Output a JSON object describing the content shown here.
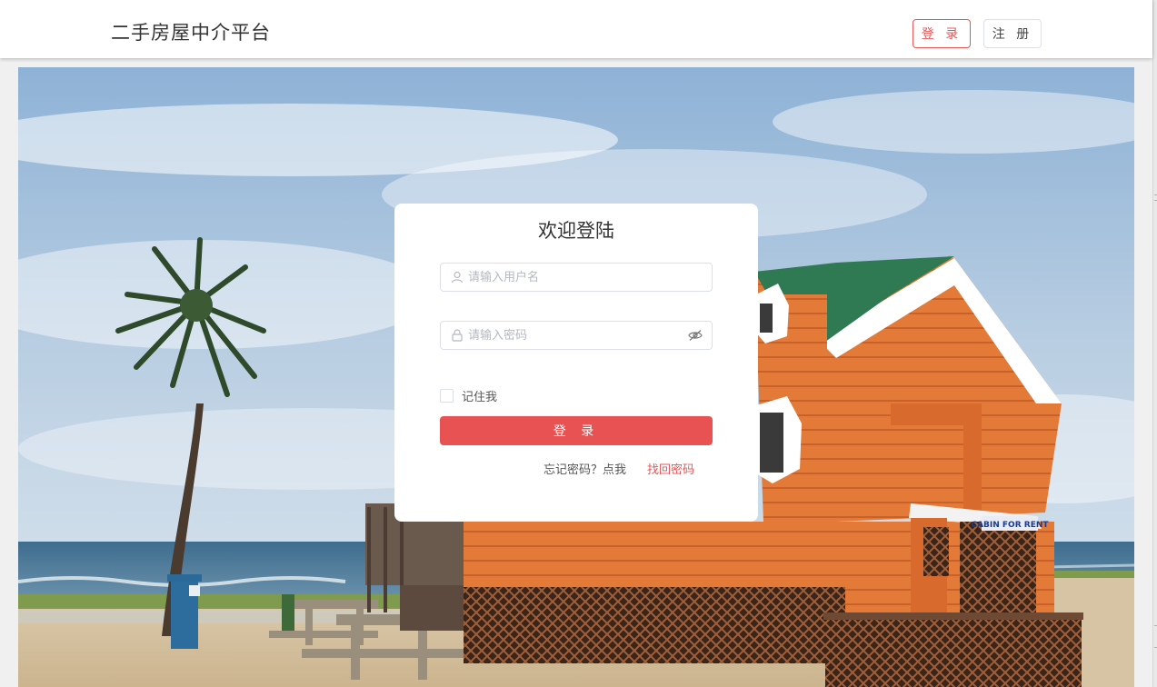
{
  "header": {
    "brand": "二手房屋中介平台",
    "login_label": "登 录",
    "register_label": "注 册"
  },
  "login_card": {
    "title": "欢迎登陆",
    "username_placeholder": "请输入用户名",
    "password_placeholder": "请输入密码",
    "remember_label": "记住我",
    "submit_label": "登 录",
    "forgot_text": "忘记密码？点我",
    "recover_link": "找回密码"
  },
  "background_sign": "CABIN FOR RENT",
  "colors": {
    "accent": "#e85252",
    "accent_text": "#e65656",
    "cabin_orange": "#e07434",
    "roof_green": "#2f7a52",
    "sky_blue": "#a9c3dc"
  },
  "icons": {
    "username": "user-icon",
    "password": "lock-icon",
    "visibility": "eye-off-icon"
  }
}
